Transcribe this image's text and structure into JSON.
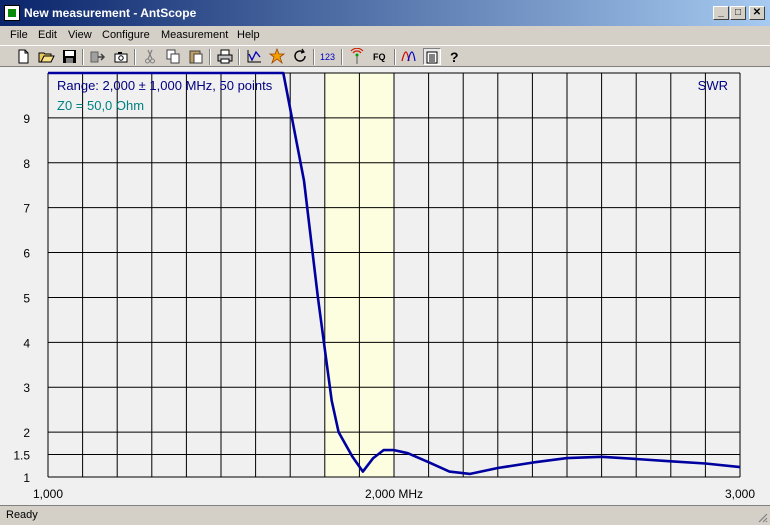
{
  "window": {
    "title": "New measurement - AntScope",
    "min_glyph": "_",
    "max_glyph": "□",
    "close_glyph": "✕"
  },
  "menu": {
    "items": [
      "File",
      "Edit",
      "View",
      "Configure",
      "Measurement",
      "Help"
    ]
  },
  "toolbar": {
    "buttons": [
      {
        "icon": "new-file-icon"
      },
      {
        "icon": "open-folder-icon"
      },
      {
        "icon": "save-icon"
      },
      {
        "icon": "export-icon"
      },
      {
        "icon": "camera-icon"
      },
      {
        "icon": "cut-icon"
      },
      {
        "icon": "copy-icon"
      },
      {
        "icon": "paste-icon"
      },
      {
        "icon": "print-icon"
      },
      {
        "icon": "chart-icon"
      },
      {
        "icon": "star-icon"
      },
      {
        "icon": "refresh-icon"
      },
      {
        "icon": "digits-icon",
        "text": "123"
      },
      {
        "icon": "antenna-icon"
      },
      {
        "icon": "fq-icon",
        "text": "FQ"
      },
      {
        "icon": "curves-icon"
      },
      {
        "icon": "list-icon",
        "pressed": true
      },
      {
        "icon": "help-icon"
      }
    ]
  },
  "status": {
    "text": "Ready"
  },
  "colors": {
    "curve": "#0000a0",
    "label": "#000080",
    "z0": "#008080",
    "band": "#fdfde0",
    "grid": "#000000"
  },
  "chart_data": {
    "type": "line",
    "info_range": "Range: 2,000 ± 1,000 MHz, 50 points",
    "info_z0": "Z0 = 50,0 Ohm",
    "series_label": "SWR",
    "xlim": [
      1.0,
      3.0
    ],
    "ylim": [
      1,
      10
    ],
    "x_ticks": [
      {
        "value": 1.0,
        "label": "1,000"
      },
      {
        "value": 2.0,
        "label": "2,000 MHz"
      },
      {
        "value": 3.0,
        "label": "3,000"
      }
    ],
    "y_ticks": [
      {
        "value": 1,
        "label": "1"
      },
      {
        "value": 1.5,
        "label": "1.5"
      },
      {
        "value": 2,
        "label": "2"
      },
      {
        "value": 3,
        "label": "3"
      },
      {
        "value": 4,
        "label": "4"
      },
      {
        "value": 5,
        "label": "5"
      },
      {
        "value": 6,
        "label": "6"
      },
      {
        "value": 7,
        "label": "7"
      },
      {
        "value": 8,
        "label": "8"
      },
      {
        "value": 9,
        "label": "9"
      }
    ],
    "y_gridlines": [
      1,
      1.5,
      2,
      3,
      4,
      5,
      6,
      7,
      8,
      9,
      10
    ],
    "x_grid_step": 0.1,
    "band": [
      1.8,
      2.0
    ],
    "series": [
      {
        "x": [
          1.0,
          1.2,
          1.4,
          1.6,
          1.68,
          1.7,
          1.74,
          1.78,
          1.82,
          1.84,
          1.88,
          1.91,
          1.94,
          1.97,
          2.0,
          2.04,
          2.1,
          2.16,
          2.22,
          2.3,
          2.4,
          2.5,
          2.6,
          2.7,
          2.8,
          2.9,
          3.0
        ],
        "y": [
          10,
          10,
          10,
          10,
          10,
          9.2,
          7.6,
          5.0,
          2.7,
          2.0,
          1.45,
          1.12,
          1.42,
          1.6,
          1.6,
          1.53,
          1.33,
          1.12,
          1.07,
          1.2,
          1.32,
          1.42,
          1.45,
          1.4,
          1.35,
          1.3,
          1.22
        ]
      }
    ]
  }
}
